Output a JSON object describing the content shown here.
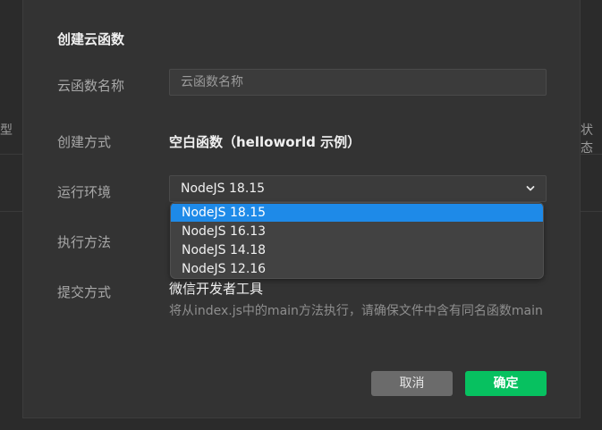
{
  "background": {
    "left_text": "类型",
    "right_text": "状态"
  },
  "dialog": {
    "title": "创建云函数",
    "fields": {
      "name": {
        "label": "云函数名称",
        "placeholder": "云函数名称",
        "value": ""
      },
      "create_method": {
        "label": "创建方式",
        "value": "空白函数（helloworld 示例）"
      },
      "runtime": {
        "label": "运行环境",
        "selected": "NodeJS 18.15",
        "options": [
          "NodeJS 18.15",
          "NodeJS 16.13",
          "NodeJS 14.18",
          "NodeJS 12.16"
        ]
      },
      "exec_method": {
        "label": "执行方法"
      },
      "submit_method": {
        "label": "提交方式",
        "value": "微信开发者工具"
      }
    },
    "hint": "将从index.js中的main方法执行，请确保文件中含有同名函数main",
    "buttons": {
      "cancel": "取消",
      "ok": "确定"
    }
  },
  "colors": {
    "accent_green": "#07c160",
    "selected_blue": "#1e8ae8"
  },
  "icons": {
    "runtime_select": "chevron-down-icon"
  }
}
